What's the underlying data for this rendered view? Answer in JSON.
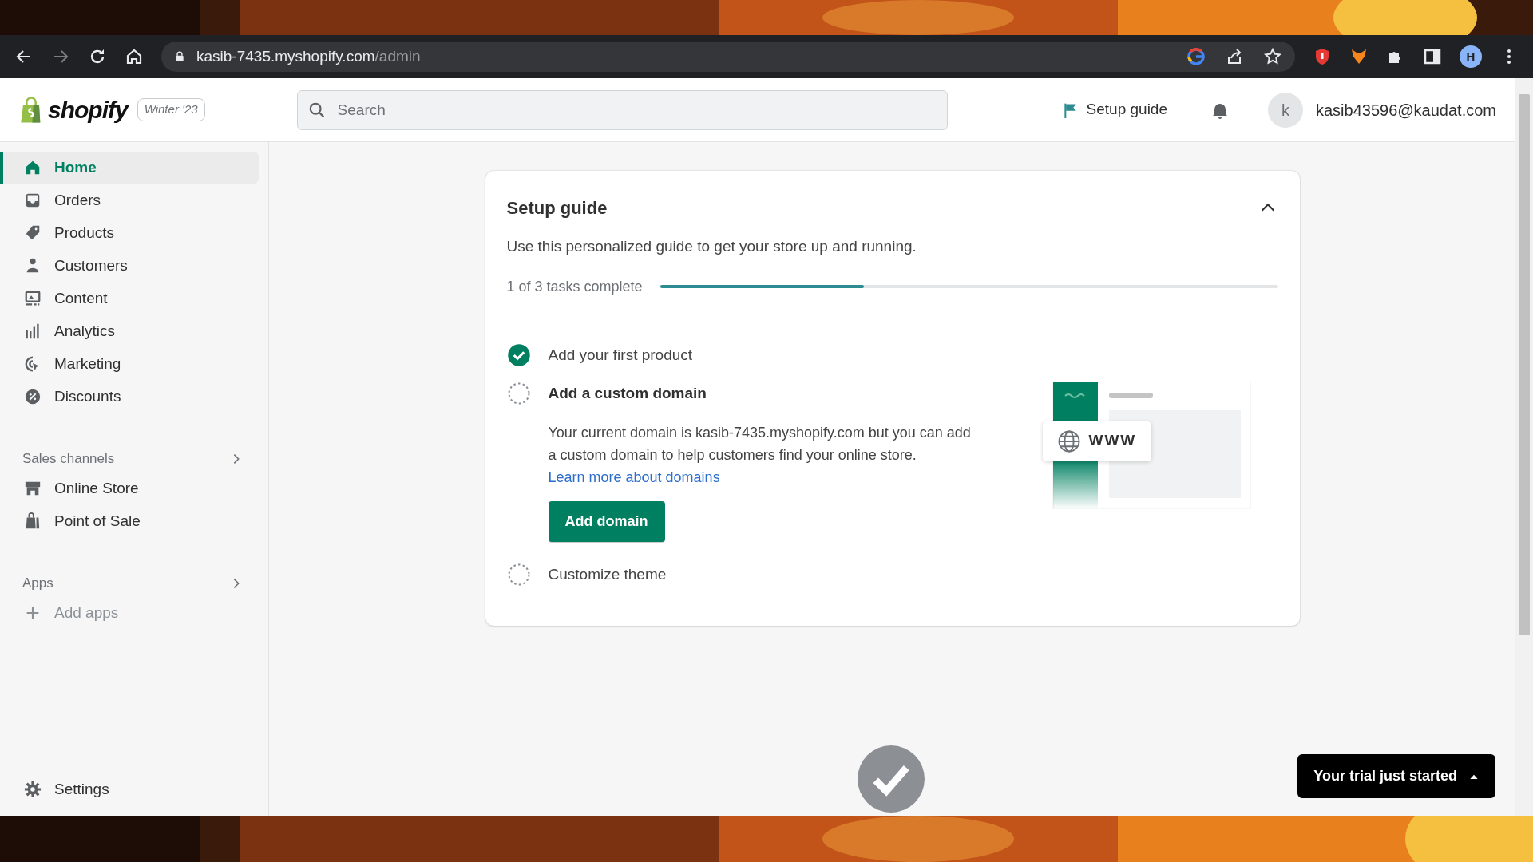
{
  "browser": {
    "url_host": "kasib-7435.myshopify.com",
    "url_path": "/admin",
    "forward_disabled": true,
    "profile_initial": "H"
  },
  "topbar": {
    "logo": "shopify",
    "edition": "Winter '23",
    "search": {
      "placeholder": "Search"
    },
    "setup_link": "Setup guide",
    "avatar_initial": "k",
    "email": "kasib43596@kaudat.com"
  },
  "sidebar": {
    "items": [
      {
        "label": "Home",
        "selected": true
      },
      {
        "label": "Orders",
        "selected": false
      },
      {
        "label": "Products",
        "selected": false
      },
      {
        "label": "Customers",
        "selected": false
      },
      {
        "label": "Content",
        "selected": false
      },
      {
        "label": "Analytics",
        "selected": false
      },
      {
        "label": "Marketing",
        "selected": false
      },
      {
        "label": "Discounts",
        "selected": false
      }
    ],
    "sections": [
      {
        "title": "Sales channels",
        "items": [
          {
            "label": "Online Store",
            "selected": false
          },
          {
            "label": "Point of Sale",
            "selected": false
          }
        ]
      },
      {
        "title": "Apps",
        "items": [
          {
            "label": "Add apps",
            "selected": false
          }
        ]
      }
    ],
    "settings": "Settings"
  },
  "setup_guide": {
    "title": "Setup guide",
    "expanded": true,
    "subtitle": "Use this personalized guide to get your store up and running.",
    "progress_text": "1 of 3 tasks complete",
    "level": 0.33,
    "tasks": [
      {
        "title": "Add your first product",
        "completed": true,
        "expanded": false
      },
      {
        "title": "Add a custom domain",
        "completed": false,
        "expanded": true,
        "description": "Your current domain is kasib-7435.myshopify.com but you can add a custom domain to help customers find your online store.",
        "link": "Learn more about domains",
        "button": "Add domain",
        "illustration_text": "WWW"
      },
      {
        "title": "Customize theme",
        "completed": false,
        "expanded": false
      }
    ]
  },
  "trial_button": "Your trial just started"
}
